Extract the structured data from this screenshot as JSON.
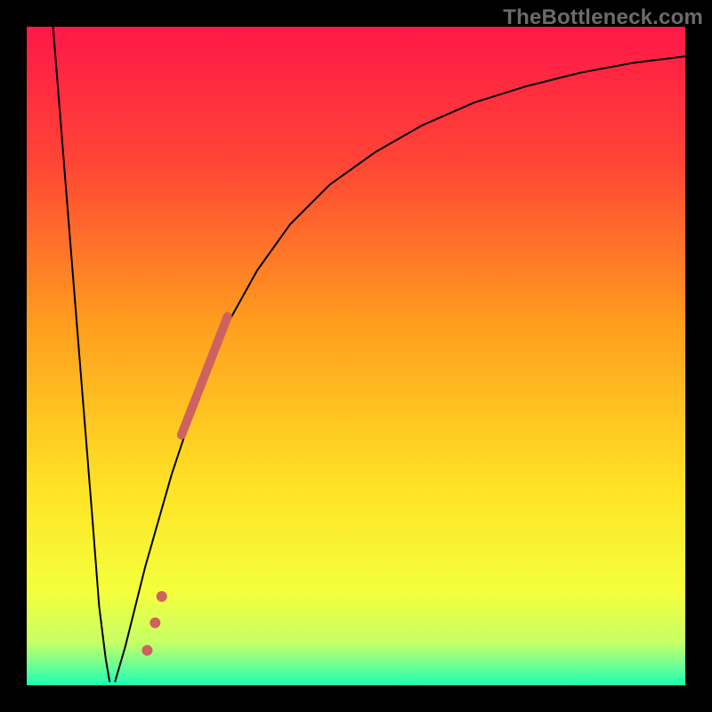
{
  "watermark": "TheBottleneck.com",
  "chart_data": {
    "type": "line",
    "title": "",
    "xlabel": "",
    "ylabel": "",
    "xlim": [
      0,
      100
    ],
    "ylim": [
      0,
      100
    ],
    "grid": false,
    "legend": false,
    "background_gradient_stops": [
      {
        "offset": 0.0,
        "color": "#ff1848"
      },
      {
        "offset": 0.2,
        "color": "#ff4336"
      },
      {
        "offset": 0.45,
        "color": "#ff9d1e"
      },
      {
        "offset": 0.7,
        "color": "#ffe324"
      },
      {
        "offset": 0.86,
        "color": "#f4ff3d"
      },
      {
        "offset": 0.935,
        "color": "#c6ff66"
      },
      {
        "offset": 0.975,
        "color": "#5fff9a"
      },
      {
        "offset": 1.0,
        "color": "#18ffb0"
      }
    ],
    "series": [
      {
        "name": "curve-left",
        "stroke": "#000000",
        "stroke_width": 2,
        "x": [
          4,
          6,
          8,
          10,
          11,
          12,
          12.6
        ],
        "y": [
          100,
          75,
          50,
          25,
          12,
          4,
          0.5
        ]
      },
      {
        "name": "curve-right",
        "stroke": "#000000",
        "stroke_width": 2,
        "x": [
          13.4,
          15,
          18,
          22,
          26,
          30,
          35,
          40,
          46,
          53,
          60,
          68,
          76,
          84,
          92,
          100
        ],
        "y": [
          0.5,
          6,
          18,
          32,
          44,
          54,
          63,
          70,
          76,
          81,
          85,
          88.5,
          91,
          93,
          94.5,
          95.5
        ]
      },
      {
        "name": "main-marker-line",
        "stroke": "#cf6161",
        "stroke_width": 10,
        "stroke_linecap": "round",
        "x": [
          23.5,
          30.5
        ],
        "y": [
          38,
          56
        ]
      }
    ],
    "scatter": [
      {
        "name": "marker-dots",
        "fill": "#cf6161",
        "r": 6,
        "points": [
          {
            "x": 18.3,
            "y": 5.3
          },
          {
            "x": 19.5,
            "y": 9.5
          },
          {
            "x": 20.5,
            "y": 13.5
          }
        ]
      }
    ]
  }
}
